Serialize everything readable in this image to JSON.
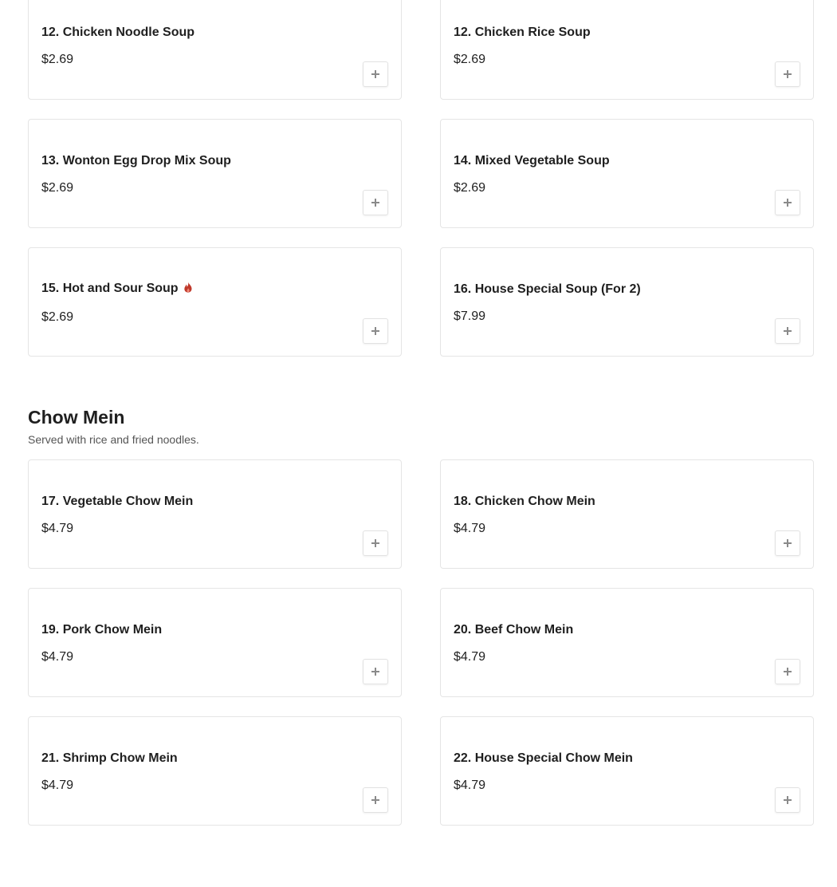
{
  "soups": [
    {
      "name": "12. Chicken Noodle Soup",
      "price": "$2.69",
      "spicy": false
    },
    {
      "name": "12. Chicken Rice Soup",
      "price": "$2.69",
      "spicy": false
    },
    {
      "name": "13. Wonton Egg Drop Mix Soup",
      "price": "$2.69",
      "spicy": false
    },
    {
      "name": "14. Mixed Vegetable Soup",
      "price": "$2.69",
      "spicy": false
    },
    {
      "name": "15. Hot and Sour Soup",
      "price": "$2.69",
      "spicy": true
    },
    {
      "name": "16. House Special Soup (For 2)",
      "price": "$7.99",
      "spicy": false
    }
  ],
  "chow_mein": {
    "title": "Chow Mein",
    "description": "Served with rice and fried noodles.",
    "items": [
      {
        "name": "17. Vegetable Chow Mein",
        "price": "$4.79"
      },
      {
        "name": "18. Chicken Chow Mein",
        "price": "$4.79"
      },
      {
        "name": "19. Pork Chow Mein",
        "price": "$4.79"
      },
      {
        "name": "20. Beef Chow Mein",
        "price": "$4.79"
      },
      {
        "name": "21. Shrimp Chow Mein",
        "price": "$4.79"
      },
      {
        "name": "22. House Special Chow Mein",
        "price": "$4.79"
      }
    ]
  },
  "icons": {
    "add": "plus-icon",
    "spicy": "flame-icon"
  },
  "colors": {
    "spicy": "#c0392b",
    "border": "#e5e5e5",
    "text": "#1f1f1f"
  }
}
